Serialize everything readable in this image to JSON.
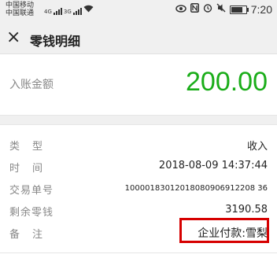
{
  "status_bar": {
    "carrier1": "中国移动",
    "carrier2": "中国联通",
    "network1": "4G",
    "network2": "3G",
    "time": "7:20",
    "battery_level": 0.8,
    "icons": [
      "wifi-icon",
      "eye-icon",
      "nfc-icon",
      "alarm-icon",
      "mute-icon",
      "battery-icon"
    ]
  },
  "header": {
    "close_icon": "×",
    "title": "零钱明细"
  },
  "amount": {
    "label": "入账金额",
    "value": "200.00",
    "color": "#1aad19"
  },
  "details": [
    {
      "label": "类型",
      "value": "收入"
    },
    {
      "label": "时间",
      "value": "2018-08-09 14:37:44"
    },
    {
      "label": "交易单号",
      "value": "10000183012018080906912208 36"
    },
    {
      "label": "剩余零钱",
      "value": "3190.58"
    },
    {
      "label": "备注",
      "value": "企业付款:雪梨"
    }
  ],
  "highlight_color": "#d60000"
}
